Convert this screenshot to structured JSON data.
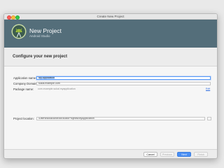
{
  "window": {
    "title": "Create New Project"
  },
  "banner": {
    "title": "New Project",
    "subtitle": "Android Studio",
    "logo_icon": "android-studio-icon",
    "background_color": "#546e7a"
  },
  "page": {
    "heading": "Configure your new project"
  },
  "form": {
    "application_name": {
      "label": "Application name:",
      "value": "My Application"
    },
    "company_domain": {
      "label": "Company Domain:",
      "value": "sukai.example.com"
    },
    "package_name": {
      "label": "Package name:",
      "value": "com.example.sukai.myapplication",
      "edit_label": "Edit"
    },
    "project_location": {
      "label": "Project location:",
      "value": "/Users/sukai/AndroidStudioProjects/MyApplication",
      "browse_label": "..."
    }
  },
  "footer": {
    "cancel": "Cancel",
    "previous": "Previous",
    "next": "Next",
    "finish": "Finish",
    "accent_color": "#4a8ff4"
  }
}
